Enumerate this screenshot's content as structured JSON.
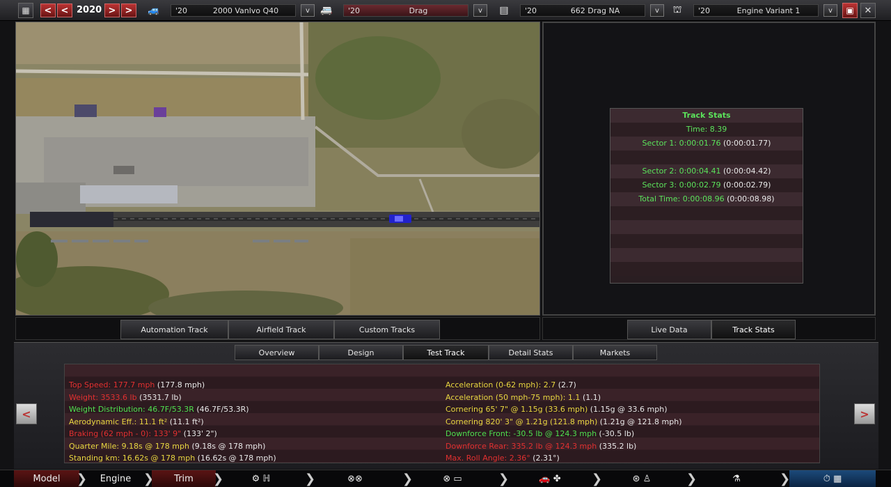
{
  "topbar": {
    "year": "2020",
    "model": {
      "year": "'20",
      "name": "2000 Vanlvo Q40"
    },
    "trim": {
      "year": "'20",
      "name": "Drag"
    },
    "engine": {
      "year": "'20",
      "name": "662 Drag NA"
    },
    "variant": {
      "year": "'20",
      "name": "Engine Variant 1"
    },
    "prev_label": "<",
    "prev2_label": "<",
    "next_label": ">",
    "next2_label": ">",
    "dropdown_label": "v",
    "close_label": "✕"
  },
  "map_tabs": [
    {
      "label": "Automation Track"
    },
    {
      "label": "Airfield Track"
    },
    {
      "label": "Custom Tracks"
    }
  ],
  "right_tabs": [
    {
      "label": "Live Data"
    },
    {
      "label": "Track Stats"
    }
  ],
  "track_stats": {
    "title": "Track Stats",
    "time": "Time: 8.39",
    "sector1": {
      "label": "Sector 1: 0:00:01.76",
      "ref": "(0:00:01.77)"
    },
    "sector2": {
      "label": "Sector 2: 0:00:04.41",
      "ref": "(0:00:04.42)"
    },
    "sector3": {
      "label": "Sector 3: 0:00:02.79",
      "ref": "(0:00:02.79)"
    },
    "total": {
      "label": "Total Time: 0:00:08.96",
      "ref": "(0:00:08.98)"
    }
  },
  "bottom_tabs": [
    {
      "label": "Overview"
    },
    {
      "label": "Design"
    },
    {
      "label": "Test Track"
    },
    {
      "label": "Detail Stats"
    },
    {
      "label": "Markets"
    }
  ],
  "stats_left": [
    {
      "label": "Top Speed: 177.7 mph",
      "ref": "(177.8 mph)",
      "color": "#e23030"
    },
    {
      "label": "Weight: 3533.6 lb",
      "ref": "(3531.7 lb)",
      "color": "#e23030"
    },
    {
      "label": "Weight Distribution: 46.7F/53.3R",
      "ref": "(46.7F/53.3R)",
      "color": "#4fe04f"
    },
    {
      "label": "Aerodynamic Eff.: 11.1 ft²",
      "ref": "(11.1 ft²)",
      "color": "#e8d640"
    },
    {
      "label": "Braking (62 mph - 0): 133' 9\"",
      "ref": "(133' 2\")",
      "color": "#e23030"
    },
    {
      "label": "Quarter Mile: 9.18s @ 178 mph",
      "ref": "(9.18s @ 178 mph)",
      "color": "#e8d640"
    },
    {
      "label": "Standing km: 16.62s @ 178 mph",
      "ref": "(16.62s @ 178 mph)",
      "color": "#e8d640"
    }
  ],
  "stats_right": [
    {
      "label": "Acceleration (0-62 mph): 2.7",
      "ref": "(2.7)",
      "color": "#e8d640"
    },
    {
      "label": "Acceleration (50 mph-75 mph): 1.1",
      "ref": "(1.1)",
      "color": "#e8d640"
    },
    {
      "label": "Cornering 65' 7\" @ 1.15g (33.6 mph)",
      "ref": "(1.15g @ 33.6 mph)",
      "color": "#e8d640"
    },
    {
      "label": "Cornering 820' 3\" @ 1.21g (121.8 mph)",
      "ref": "(1.21g @ 121.8 mph)",
      "color": "#e8d640"
    },
    {
      "label": "Downforce Front: -30.5 lb @ 124.3 mph",
      "ref": "(-30.5 lb)",
      "color": "#4fe04f"
    },
    {
      "label": "Downforce Rear: 335.2 lb @ 124.3 mph",
      "ref": "(335.2 lb)",
      "color": "#e23030"
    },
    {
      "label": "Max. Roll Angle: 2.36°",
      "ref": "(2.31°)",
      "color": "#e23030"
    }
  ],
  "arrows": {
    "left": "<",
    "right": ">"
  },
  "nav": {
    "model": "Model",
    "engine": "Engine",
    "trim": "Trim"
  }
}
